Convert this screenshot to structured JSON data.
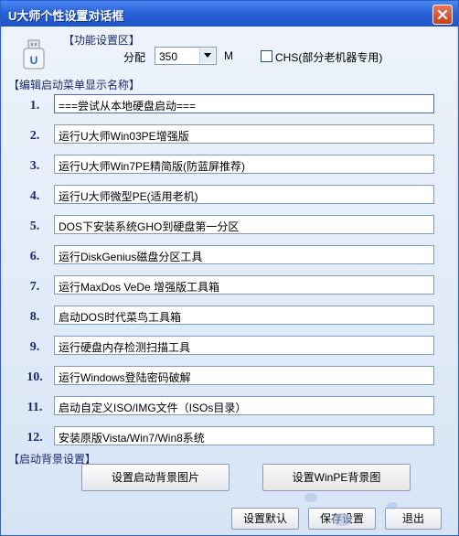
{
  "window": {
    "title": "U大师个性设置对话框"
  },
  "function_section": {
    "header": "【功能设置区】",
    "partition_label": "分配",
    "partition_value": "350",
    "unit": "M",
    "chs_checked": false,
    "chs_label": "CHS(部分老机器专用)"
  },
  "menu_section": {
    "header": "【编辑启动菜单显示名称】",
    "items": [
      {
        "num": "1.",
        "text": "===尝试从本地硬盘启动==="
      },
      {
        "num": "2.",
        "text": "运行U大师Win03PE增强版"
      },
      {
        "num": "3.",
        "text": "运行U大师Win7PE精简版(防蓝屏推荐)"
      },
      {
        "num": "4.",
        "text": "运行U大师微型PE(适用老机)"
      },
      {
        "num": "5.",
        "text": "DOS下安装系统GHO到硬盘第一分区"
      },
      {
        "num": "6.",
        "text": "运行DiskGenius磁盘分区工具"
      },
      {
        "num": "7.",
        "text": "运行MaxDos VeDe 增强版工具箱"
      },
      {
        "num": "8.",
        "text": "启动DOS时代菜鸟工具箱"
      },
      {
        "num": "9.",
        "text": "运行硬盘内存检测扫描工具"
      },
      {
        "num": "10.",
        "text": "运行Windows登陆密码破解"
      },
      {
        "num": "11.",
        "text": "启动自定义ISO/IMG文件（ISOs目录）"
      },
      {
        "num": "12.",
        "text": "安装原版Vista/Win7/Win8系统"
      }
    ]
  },
  "background_section": {
    "header": "【启动背景设置】",
    "set_bg_image": "设置启动背景图片",
    "set_winpe_bg": "设置WinPE背景图"
  },
  "footer": {
    "reset_default": "设置默认",
    "save_settings": "保存设置",
    "exit": "退出"
  },
  "colors": {
    "titlebar": "#2a63d8",
    "section_text": "#1a2a6b"
  }
}
